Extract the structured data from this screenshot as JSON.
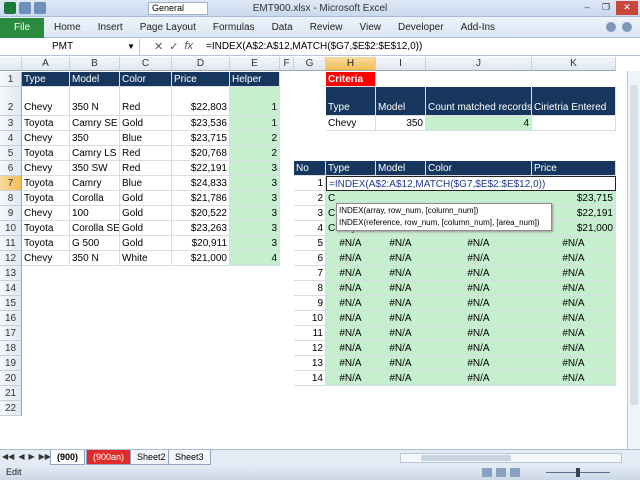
{
  "window": {
    "title": "EMT900.xlsx - Microsoft Excel",
    "style_box": "General"
  },
  "ribbon": {
    "file": "File",
    "tabs": [
      "Home",
      "Insert",
      "Page Layout",
      "Formulas",
      "Data",
      "Review",
      "View",
      "Developer",
      "Add-Ins"
    ]
  },
  "formula_bar": {
    "name_box": "PMT",
    "formula": "=INDEX(A$2:A$12,MATCH($G7,$E$2:$E$12,0))"
  },
  "columns": [
    "A",
    "B",
    "C",
    "D",
    "E",
    "F",
    "G",
    "H",
    "I",
    "J",
    "K"
  ],
  "rows": [
    "1",
    "2",
    "3",
    "4",
    "5",
    "6",
    "7",
    "8",
    "9",
    "10",
    "11",
    "12",
    "13",
    "14",
    "15",
    "16",
    "17",
    "18",
    "19",
    "20",
    "21",
    "22"
  ],
  "left_table": {
    "headers": [
      "Type",
      "Model",
      "Color",
      "Price",
      "Helper"
    ],
    "rows": [
      [
        "Chevy",
        "350 N",
        "Red",
        "$22,803",
        "1"
      ],
      [
        "Toyota",
        "Camry SE",
        "Gold",
        "$23,536",
        "1"
      ],
      [
        "Chevy",
        "350",
        "Blue",
        "$23,715",
        "2"
      ],
      [
        "Toyota",
        "Camry LS",
        "Red",
        "$20,768",
        "2"
      ],
      [
        "Chevy",
        "350 SW",
        "Red",
        "$22,191",
        "3"
      ],
      [
        "Toyota",
        "Camry",
        "Blue",
        "$24,833",
        "3"
      ],
      [
        "Toyota",
        "Corolla",
        "Gold",
        "$21,786",
        "3"
      ],
      [
        "Chevy",
        "100",
        "Gold",
        "$20,522",
        "3"
      ],
      [
        "Toyota",
        "Corolla SE",
        "Gold",
        "$23,263",
        "3"
      ],
      [
        "Toyota",
        "G 500",
        "Gold",
        "$20,911",
        "3"
      ],
      [
        "Chevy",
        "350 N",
        "White",
        "$21,000",
        "4"
      ]
    ]
  },
  "criteria": {
    "title": "Criteria",
    "headers": [
      "Type",
      "Model",
      "Count matched records",
      "Cirietria Entered"
    ],
    "values": [
      "Chevy",
      "350",
      "4",
      ""
    ]
  },
  "result_table": {
    "headers": [
      "No",
      "Type",
      "Model",
      "Color",
      "Price"
    ],
    "rows": [
      [
        "1",
        "=INDEX(A$2:A$12,MATCH($G7,$E$2:$E$12,0))",
        "",
        "",
        ""
      ],
      [
        "2",
        "C",
        "",
        "",
        "$23,715"
      ],
      [
        "3",
        "C",
        "",
        "",
        "$22,191"
      ],
      [
        "4",
        "Chevy",
        "350 N",
        "White",
        "$21,000"
      ],
      [
        "5",
        "#N/A",
        "#N/A",
        "#N/A",
        "#N/A"
      ],
      [
        "6",
        "#N/A",
        "#N/A",
        "#N/A",
        "#N/A"
      ],
      [
        "7",
        "#N/A",
        "#N/A",
        "#N/A",
        "#N/A"
      ],
      [
        "8",
        "#N/A",
        "#N/A",
        "#N/A",
        "#N/A"
      ],
      [
        "9",
        "#N/A",
        "#N/A",
        "#N/A",
        "#N/A"
      ],
      [
        "10",
        "#N/A",
        "#N/A",
        "#N/A",
        "#N/A"
      ],
      [
        "11",
        "#N/A",
        "#N/A",
        "#N/A",
        "#N/A"
      ],
      [
        "12",
        "#N/A",
        "#N/A",
        "#N/A",
        "#N/A"
      ],
      [
        "13",
        "#N/A",
        "#N/A",
        "#N/A",
        "#N/A"
      ],
      [
        "14",
        "#N/A",
        "#N/A",
        "#N/A",
        "#N/A"
      ]
    ]
  },
  "autocomplete": [
    "INDEX(array, row_num, [column_num])",
    "INDEX(reference, row_num, [column_num], [area_num])"
  ],
  "sheets": [
    "(900)",
    "(900an)",
    "Sheet2",
    "Sheet3"
  ],
  "status": {
    "mode": "Edit"
  },
  "colors": {
    "header_blue": "#17365d",
    "green_fill": "#c6efce",
    "criteria_red": "#ff0000",
    "file_green": "#2a8a3e"
  }
}
